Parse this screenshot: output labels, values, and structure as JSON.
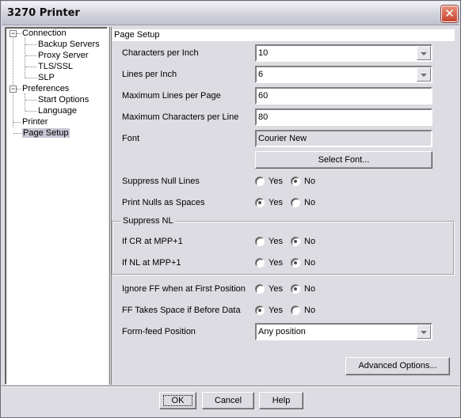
{
  "window": {
    "title": "3270 Printer",
    "close_icon": "close-x-icon"
  },
  "tree": {
    "items": [
      {
        "label": "Connection",
        "level": 0,
        "expanded": true
      },
      {
        "label": "Backup Servers",
        "level": 1
      },
      {
        "label": "Proxy Server",
        "level": 1
      },
      {
        "label": "TLS/SSL",
        "level": 1
      },
      {
        "label": "SLP",
        "level": 1
      },
      {
        "label": "Preferences",
        "level": 0,
        "expanded": true
      },
      {
        "label": "Start Options",
        "level": 1
      },
      {
        "label": "Language",
        "level": 1
      },
      {
        "label": "Printer",
        "level": 0
      },
      {
        "label": "Page Setup",
        "level": 0,
        "selected": true
      }
    ],
    "expander_symbol": "−"
  },
  "page": {
    "header": "Page Setup",
    "chars_per_inch": {
      "label": "Characters per Inch",
      "value": "10"
    },
    "lines_per_inch": {
      "label": "Lines per Inch",
      "value": "6"
    },
    "max_lines": {
      "label": "Maximum Lines per Page",
      "value": "60"
    },
    "max_chars": {
      "label": "Maximum Characters per Line",
      "value": "80"
    },
    "font": {
      "label": "Font",
      "value": "Courier New",
      "select_button": "Select Font..."
    },
    "suppress_null_lines": {
      "label": "Suppress Null Lines",
      "selected": "No"
    },
    "print_nulls_as_spaces": {
      "label": "Print Nulls as Spaces",
      "selected": "Yes"
    },
    "suppress_nl": {
      "title": "Suppress NL",
      "if_cr": {
        "label": "If CR at MPP+1",
        "selected": "No"
      },
      "if_nl": {
        "label": "If NL at MPP+1",
        "selected": "No"
      }
    },
    "ignore_ff": {
      "label": "Ignore FF when at First Position",
      "selected": "No"
    },
    "ff_takes_space": {
      "label": "FF Takes Space if Before Data",
      "selected": "Yes"
    },
    "form_feed_position": {
      "label": "Form-feed Position",
      "value": "Any position"
    },
    "advanced_button": "Advanced Options...",
    "yes_label": "Yes",
    "no_label": "No"
  },
  "footer": {
    "ok": "OK",
    "cancel": "Cancel",
    "help": "Help"
  }
}
